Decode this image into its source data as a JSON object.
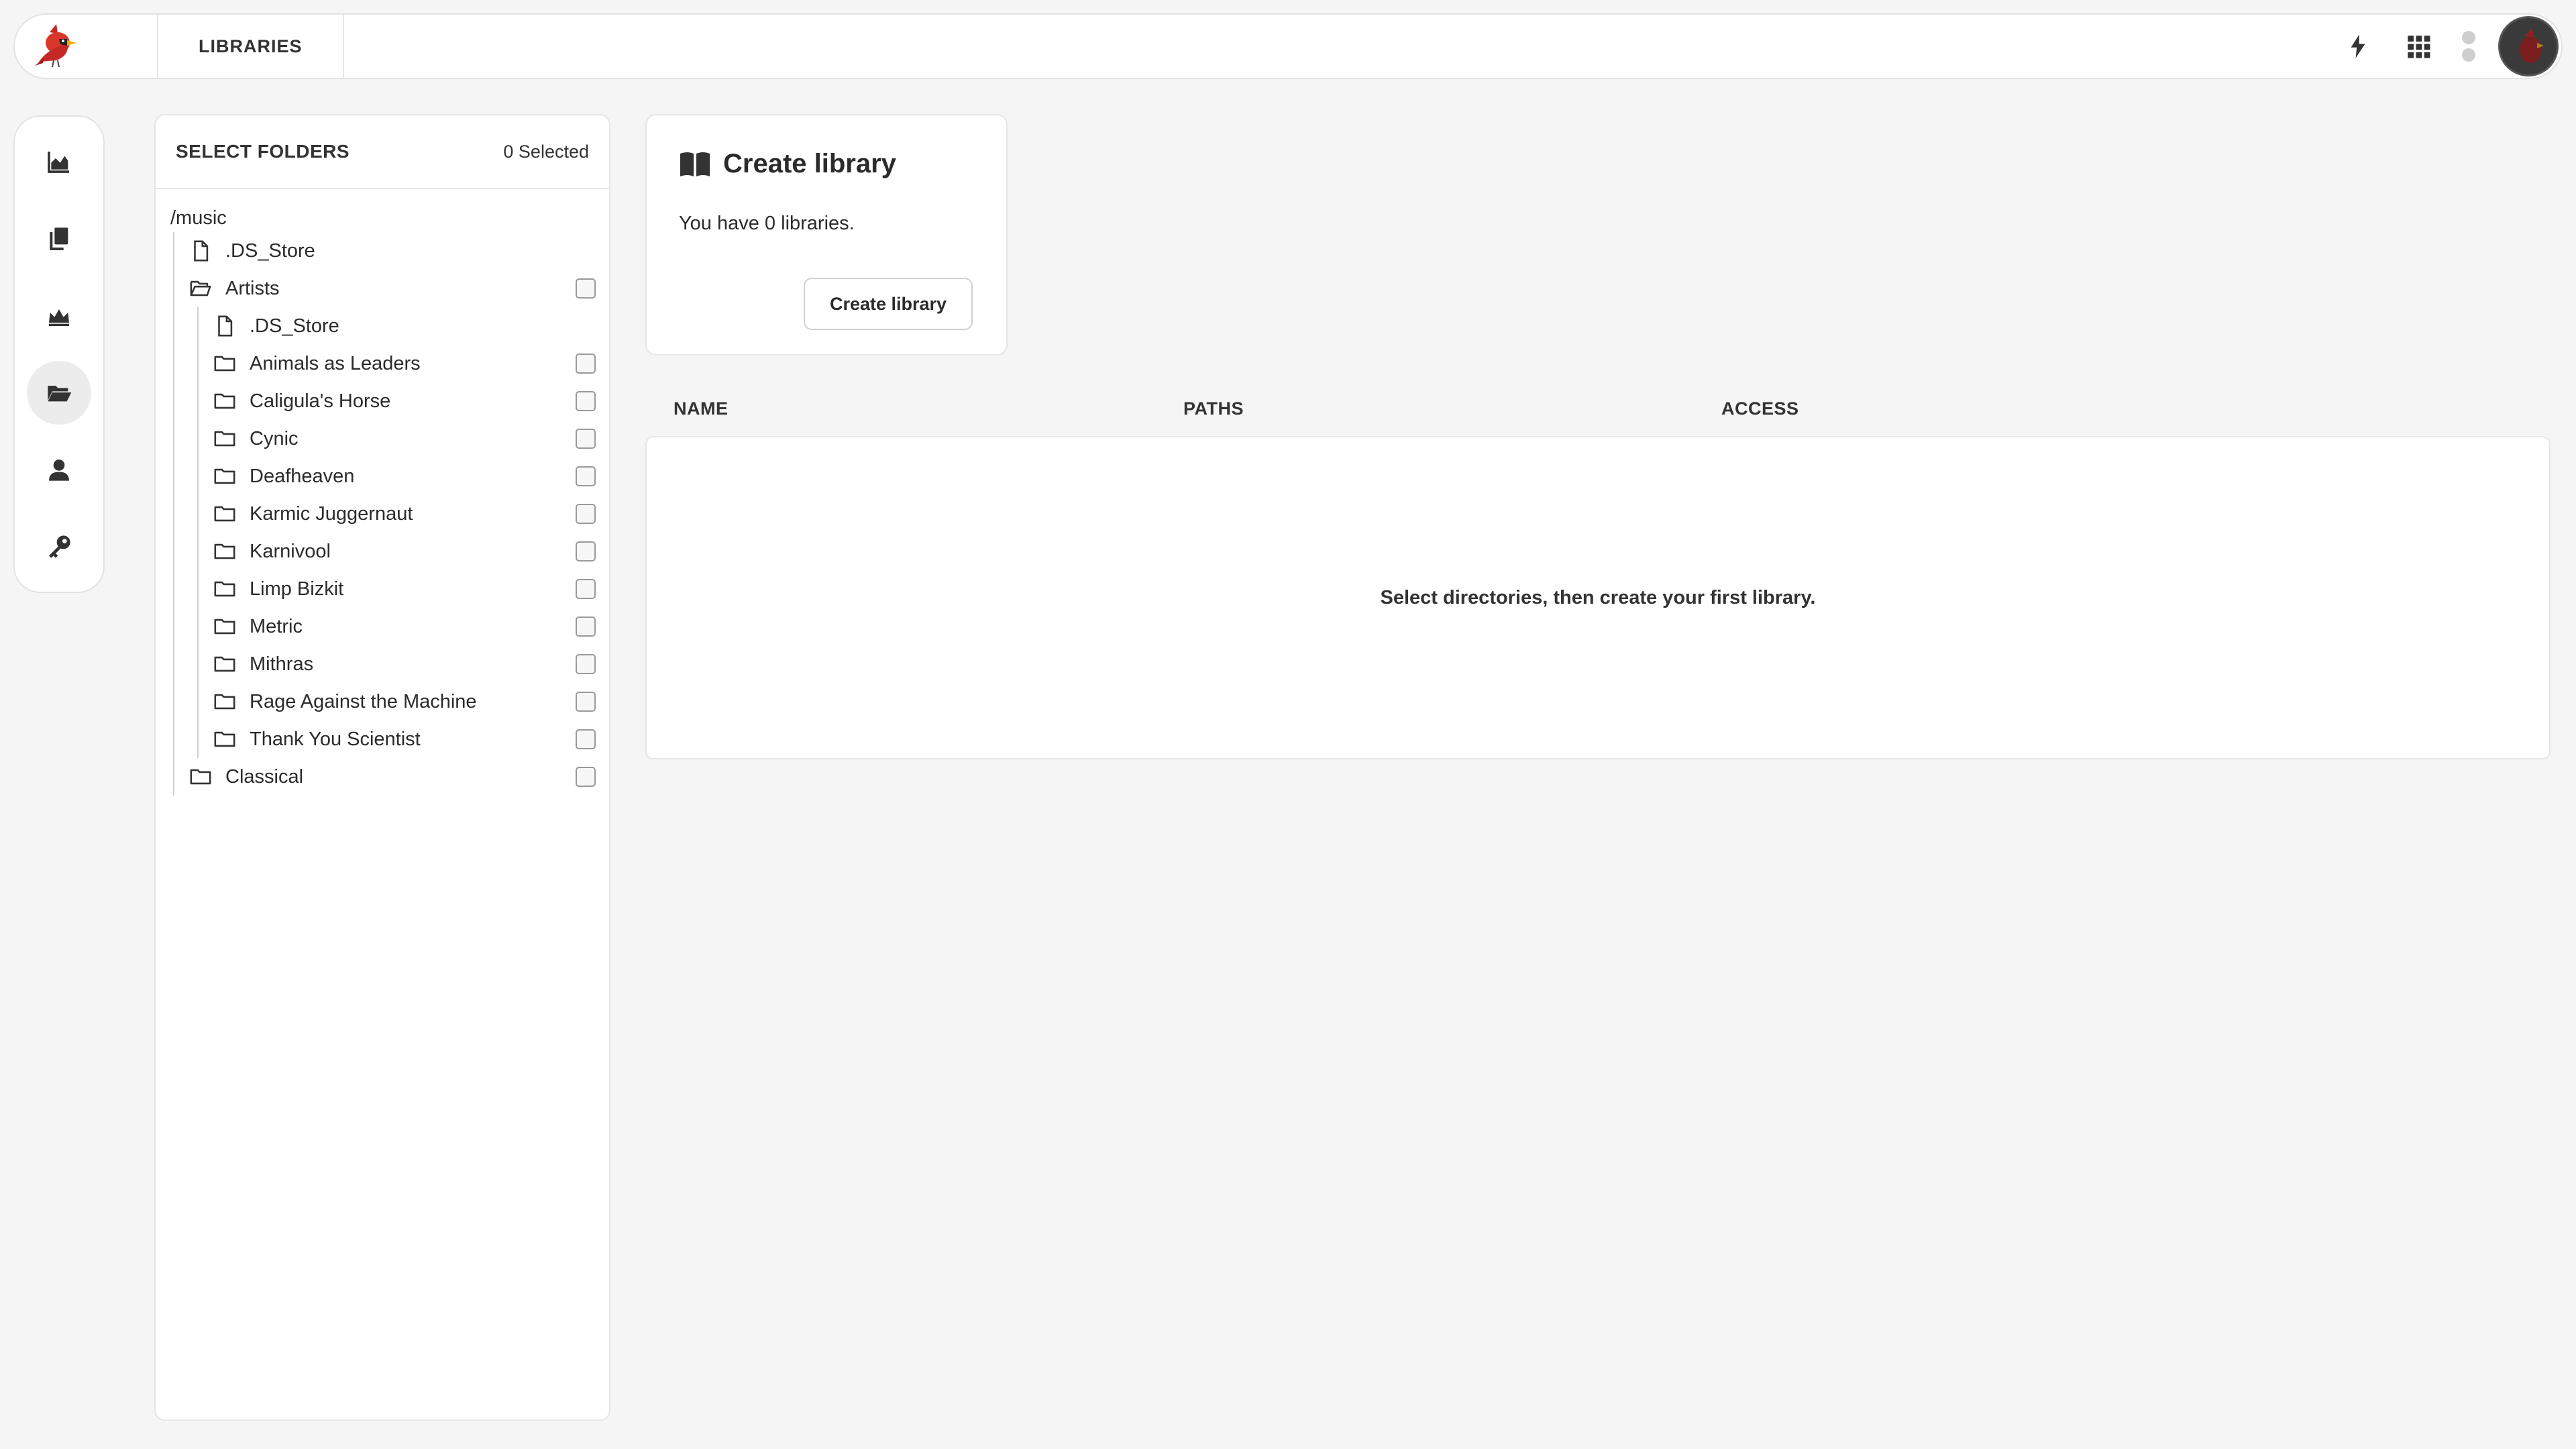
{
  "topbar": {
    "page_tab": "LIBRARIES",
    "icons": [
      "cardinal-logo",
      "lightning-icon",
      "apps-grid-icon",
      "status-dots",
      "avatar"
    ]
  },
  "sidenav": {
    "items": [
      {
        "icon": "chart-area-icon",
        "active": false
      },
      {
        "icon": "copy-icon",
        "active": false
      },
      {
        "icon": "crown-icon",
        "active": false
      },
      {
        "icon": "folder-open-icon",
        "active": true
      },
      {
        "icon": "user-icon",
        "active": false
      },
      {
        "icon": "key-icon",
        "active": false
      }
    ]
  },
  "folders": {
    "title": "SELECT FOLDERS",
    "selected_count": "0 Selected",
    "root": "/music",
    "root_file": ".DS_Store",
    "artists": {
      "label": "Artists",
      "file": ".DS_Store",
      "children": [
        "Animals as Leaders",
        "Caligula's Horse",
        "Cynic",
        "Deafheaven",
        "Karmic Juggernaut",
        "Karnivool",
        "Limp Bizkit",
        "Metric",
        "Mithras",
        "Rage Against the Machine",
        "Thank You Scientist"
      ]
    },
    "classical": "Classical"
  },
  "create_card": {
    "title": "Create library",
    "description": "You have 0 libraries.",
    "button_label": "Create library"
  },
  "table": {
    "columns": [
      "NAME",
      "PATHS",
      "ACCESS"
    ],
    "empty_message": "Select directories, then create your first library."
  },
  "colors": {
    "background": "#f5f5f5",
    "panel": "#ffffff",
    "border": "#e6e6e6",
    "text": "#2b2b2b",
    "accent": "#d9372b"
  }
}
